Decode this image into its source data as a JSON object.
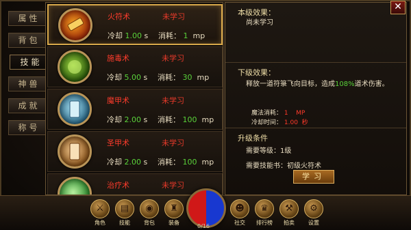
{
  "tabs": [
    "属性",
    "背包",
    "技能",
    "神兽",
    "成就",
    "称号"
  ],
  "active_tab": "技能",
  "skills": [
    {
      "name": "火符术",
      "state": "未学习",
      "cd_label": "冷却",
      "cd": "1.00",
      "cd_unit": "s",
      "cost_label": "消耗：",
      "cost": "1",
      "cost_unit": "mp",
      "color": "#c83a10"
    },
    {
      "name": "施毒术",
      "state": "未学习",
      "cd_label": "冷却",
      "cd": "5.00",
      "cd_unit": "s",
      "cost_label": "消耗：",
      "cost": "30",
      "cost_unit": "mp",
      "color": "#4a8a1a"
    },
    {
      "name": "魔甲术",
      "state": "未学习",
      "cd_label": "冷却",
      "cd": "2.00",
      "cd_unit": "s",
      "cost_label": "消耗：",
      "cost": "100",
      "cost_unit": "mp",
      "color": "#3a8aa8"
    },
    {
      "name": "圣甲术",
      "state": "未学习",
      "cd_label": "冷却",
      "cd": "2.00",
      "cd_unit": "s",
      "cost_label": "消耗：",
      "cost": "100",
      "cost_unit": "mp",
      "color": "#b87a3a"
    },
    {
      "name": "治疗术",
      "state": "未学习",
      "color": "#3aa83a"
    }
  ],
  "detail": {
    "current_title": "本级效果：",
    "current_state": "尚未学习",
    "next_title": "下级效果：",
    "next_desc_pre": "释放一道符箓飞向目标，造成",
    "next_desc_pct": "108%",
    "next_desc_post": "道术伤害。",
    "mp_label": "魔法消耗：",
    "mp_value": "1",
    "mp_unit": "MP",
    "cd_label": "冷却时间：",
    "cd_value": "1.00",
    "cd_unit": "秒",
    "upgrade_title": "升级条件",
    "req_level": "需要等级：1级",
    "req_book": "需要技能书：初级火符术",
    "learn_button": "学习"
  },
  "close": "✕",
  "bottom_bar": {
    "left_buttons": [
      "角色",
      "技能",
      "背包",
      "装备"
    ],
    "right_buttons": [
      "社交",
      "排行榜",
      "拍卖",
      "设置"
    ],
    "exp_text": "0/16"
  }
}
